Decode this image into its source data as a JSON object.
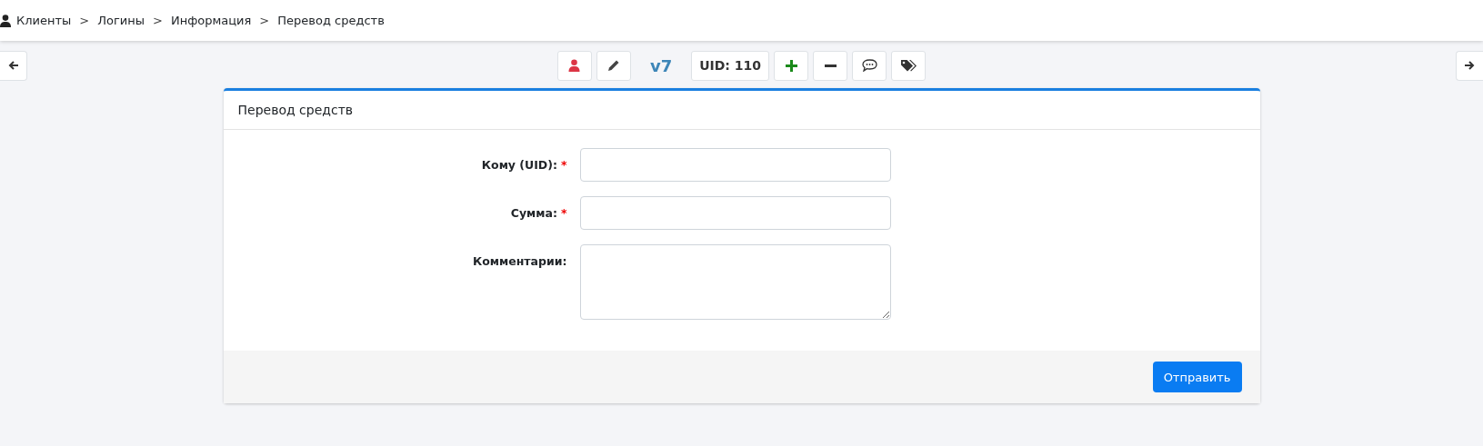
{
  "breadcrumbs": [
    {
      "label": "Клиенты",
      "separator": ">"
    },
    {
      "label": "Логины",
      "separator": ">"
    },
    {
      "label": "Информация",
      "separator": ">"
    },
    {
      "label": "Перевод средств"
    }
  ],
  "toolbar": [
    {
      "kind": "person"
    },
    {
      "kind": "pencil"
    },
    {
      "kind": "version",
      "label": "v7"
    },
    {
      "kind": "text",
      "label": "UID: 110"
    },
    {
      "kind": "plus"
    },
    {
      "kind": "minus"
    },
    {
      "kind": "chat"
    },
    {
      "kind": "tags"
    }
  ],
  "card": {
    "title": "Перевод средств",
    "fields": [
      {
        "kind": "input",
        "label": "Кому (UID):",
        "required_mark": "*"
      },
      {
        "kind": "input",
        "label": "Сумма:",
        "required_mark": "*"
      },
      {
        "kind": "textarea",
        "label": "Комментарии:"
      }
    ],
    "submit": "Отправить"
  }
}
